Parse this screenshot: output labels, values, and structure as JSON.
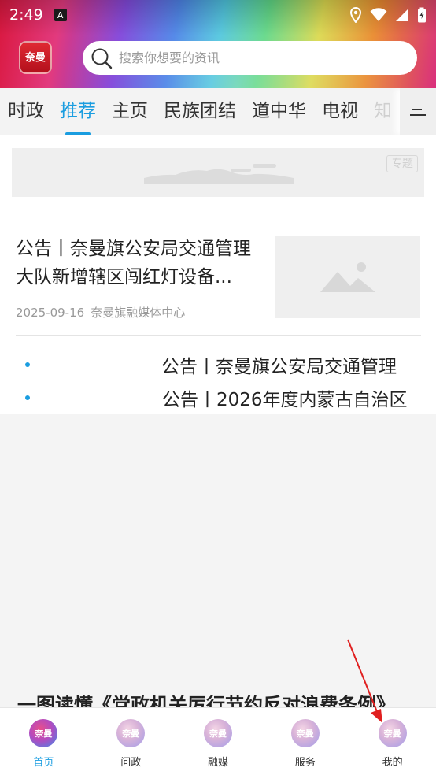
{
  "status_bar": {
    "time": "2:49",
    "notification_badge": "A"
  },
  "header": {
    "logo_text": "奈曼",
    "search": {
      "placeholder": "搜索你想要的资讯"
    }
  },
  "tabs": [
    {
      "label": "时政",
      "active": false
    },
    {
      "label": "推荐",
      "active": true
    },
    {
      "label": "主页",
      "active": false
    },
    {
      "label": "民族团结",
      "active": false
    },
    {
      "label": "道中华",
      "active": false
    },
    {
      "label": "电视",
      "active": false
    },
    {
      "label": "知",
      "active": false
    }
  ],
  "banner": {
    "badge": "专题"
  },
  "news": {
    "title": "公告丨奈曼旗公安局交通管理大队新增辖区闯红灯设备...",
    "date": "2025-09-16",
    "source": "奈曼旗融媒体中心"
  },
  "marquee": [
    {
      "text": "公告丨奈曼旗公安局交通管理"
    },
    {
      "text": "公告丨2026年度内蒙古自治区"
    }
  ],
  "partial_headline": "一图读懂《党政机关厉行节约反对浪费条例》",
  "bottom_nav": [
    {
      "label": "首页",
      "active": true
    },
    {
      "label": "问政",
      "active": false
    },
    {
      "label": "融媒",
      "active": false
    },
    {
      "label": "服务",
      "active": false
    },
    {
      "label": "我的",
      "active": false
    }
  ],
  "colors": {
    "accent": "#1a9de0",
    "annotation_arrow": "#e02020"
  },
  "icons": {
    "status": [
      "location-icon",
      "wifi-icon",
      "signal-icon",
      "battery-icon"
    ],
    "search": "search-icon",
    "tabs_menu": "menu-icon",
    "placeholder": "image-placeholder-icon"
  }
}
